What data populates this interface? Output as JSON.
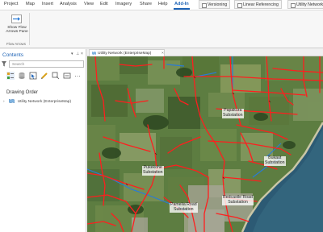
{
  "ribbon": {
    "tabs": [
      "Project",
      "Map",
      "Insert",
      "Analysis",
      "View",
      "Edit",
      "Imagery",
      "Share",
      "Help",
      "Add-In"
    ],
    "active_tab": "Add-In",
    "contextual_tabs": [
      "Versioning",
      "Linear Referencing",
      "Utility Network"
    ],
    "group": {
      "button_label": "Show Flow Arrows Pane",
      "group_label": "Flow Arrows"
    }
  },
  "contents": {
    "title": "Contents",
    "search_placeholder": "Search",
    "drawing_order_label": "Drawing Order",
    "layer_name": "Utility Network (EnterpriseMap)"
  },
  "map_view": {
    "tab_label": "Utility Network (EnterpriseMap)",
    "close_glyph": "×",
    "labels": {
      "papakura": "Papakura\nSubstation",
      "pukekohe": "Pukekohe\nSubstation",
      "bukaut": "Bukaut\nSubstation",
      "pamelia_road": "Pamelia Road\nSubstation",
      "redcastle_road": "Redcastle Road\nSubstation"
    }
  },
  "colors": {
    "accent": "#1d63b6",
    "network_line": "#ff1e1e",
    "water_line": "#2a7bd6",
    "sea": "#2c5a74",
    "land": "#5a7a40"
  }
}
